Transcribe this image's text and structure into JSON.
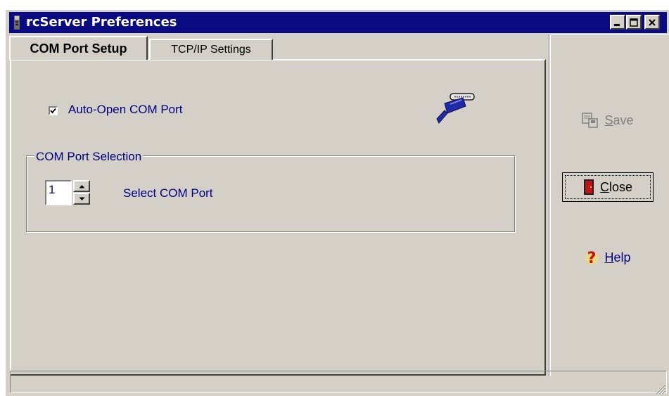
{
  "window": {
    "title": "rcServer Preferences",
    "title_icon": "app-icon",
    "controls": [
      "minimize-icon",
      "maximize-icon",
      "close-icon"
    ]
  },
  "tabs": [
    {
      "label": "COM Port Setup",
      "active": true
    },
    {
      "label": "TCP/IP Settings",
      "active": false
    }
  ],
  "com_port_setup": {
    "auto_open": {
      "label": "Auto-Open COM Port",
      "checked": true
    },
    "connector_icon": "serial-cable-icon",
    "group": {
      "title": "COM Port Selection",
      "port_value": "1",
      "select_label": "Select COM Port"
    }
  },
  "buttons": {
    "save": {
      "label": "Save",
      "enabled": false,
      "icon": "save-icon"
    },
    "close": {
      "label": "Close",
      "enabled": true,
      "icon": "door-icon"
    },
    "help": {
      "label": "Help",
      "enabled": true,
      "icon": "help-icon"
    }
  },
  "colors": {
    "titlebar": "#0a0a82",
    "face": "#d4d0c8",
    "label_text": "#000080"
  }
}
